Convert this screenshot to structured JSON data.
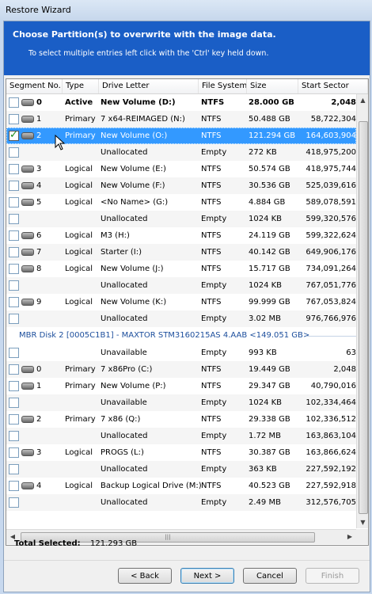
{
  "window": {
    "title": "Restore Wizard"
  },
  "banner": {
    "heading": "Choose  Partition(s)  to overwrite with the image data.",
    "subtext": "To select multiple entries left click with the 'Ctrl' key held down."
  },
  "columns": [
    "Segment No.",
    "Type",
    "Drive Letter",
    "File System",
    "Size",
    "Start Sector"
  ],
  "rows_a": [
    {
      "checked": false,
      "disk": true,
      "seg": "0",
      "type": "Active",
      "drive": "New Volume (D:)",
      "fs": "NTFS",
      "size": "28.000 GB",
      "start": "2,048",
      "style": "bold"
    },
    {
      "checked": false,
      "disk": true,
      "seg": "1",
      "type": "Primary",
      "drive": "7 x64-REIMAGED (N:)",
      "fs": "NTFS",
      "size": "50.488 GB",
      "start": "58,722,304",
      "style": ""
    },
    {
      "checked": true,
      "disk": true,
      "seg": "2",
      "type": "Primary",
      "drive": "New Volume (O:)",
      "fs": "NTFS",
      "size": "121.294 GB",
      "start": "164,603,904",
      "style": "sel"
    },
    {
      "checked": false,
      "disk": false,
      "seg": "",
      "type": "",
      "drive": "Unallocated",
      "fs": "Empty",
      "size": "272 KB",
      "start": "418,975,200",
      "style": ""
    },
    {
      "checked": false,
      "disk": true,
      "seg": "3",
      "type": "Logical",
      "drive": "New Volume (E:)",
      "fs": "NTFS",
      "size": "50.574 GB",
      "start": "418,975,744",
      "style": ""
    },
    {
      "checked": false,
      "disk": true,
      "seg": "4",
      "type": "Logical",
      "drive": "New Volume (F:)",
      "fs": "NTFS",
      "size": "30.536 GB",
      "start": "525,039,616",
      "style": ""
    },
    {
      "checked": false,
      "disk": true,
      "seg": "5",
      "type": "Logical",
      "drive": "<No Name> (G:)",
      "fs": "NTFS",
      "size": "4.884 GB",
      "start": "589,078,591",
      "style": ""
    },
    {
      "checked": false,
      "disk": false,
      "seg": "",
      "type": "",
      "drive": "Unallocated",
      "fs": "Empty",
      "size": "1024 KB",
      "start": "599,320,576",
      "style": ""
    },
    {
      "checked": false,
      "disk": true,
      "seg": "6",
      "type": "Logical",
      "drive": "M3 (H:)",
      "fs": "NTFS",
      "size": "24.119 GB",
      "start": "599,322,624",
      "style": ""
    },
    {
      "checked": false,
      "disk": true,
      "seg": "7",
      "type": "Logical",
      "drive": "Starter (I:)",
      "fs": "NTFS",
      "size": "40.142 GB",
      "start": "649,906,176",
      "style": ""
    },
    {
      "checked": false,
      "disk": true,
      "seg": "8",
      "type": "Logical",
      "drive": "New Volume (J:)",
      "fs": "NTFS",
      "size": "15.717 GB",
      "start": "734,091,264",
      "style": ""
    },
    {
      "checked": false,
      "disk": false,
      "seg": "",
      "type": "",
      "drive": "Unallocated",
      "fs": "Empty",
      "size": "1024 KB",
      "start": "767,051,776",
      "style": ""
    },
    {
      "checked": false,
      "disk": true,
      "seg": "9",
      "type": "Logical",
      "drive": "New Volume (K:)",
      "fs": "NTFS",
      "size": "99.999 GB",
      "start": "767,053,824",
      "style": ""
    },
    {
      "checked": false,
      "disk": false,
      "seg": "",
      "type": "",
      "drive": "Unallocated",
      "fs": "Empty",
      "size": "3.02 MB",
      "start": "976,766,976",
      "style": ""
    }
  ],
  "group_label": "MBR Disk 2 [0005C1B1] - MAXTOR STM3160215AS 4.AAB  <149.051 GB>",
  "rows_b": [
    {
      "checked": false,
      "disk": false,
      "seg": "",
      "type": "",
      "drive": "Unavailable",
      "fs": "Empty",
      "size": "993 KB",
      "start": "63",
      "style": ""
    },
    {
      "checked": false,
      "disk": true,
      "seg": "0",
      "type": "Primary",
      "drive": "7 x86Pro (C:)",
      "fs": "NTFS",
      "size": "19.449 GB",
      "start": "2,048",
      "style": ""
    },
    {
      "checked": false,
      "disk": true,
      "seg": "1",
      "type": "Primary",
      "drive": "New Volume (P:)",
      "fs": "NTFS",
      "size": "29.347 GB",
      "start": "40,790,016",
      "style": ""
    },
    {
      "checked": false,
      "disk": false,
      "seg": "",
      "type": "",
      "drive": "Unavailable",
      "fs": "Empty",
      "size": "1024 KB",
      "start": "102,334,464",
      "style": ""
    },
    {
      "checked": false,
      "disk": true,
      "seg": "2",
      "type": "Primary",
      "drive": "7 x86 (Q:)",
      "fs": "NTFS",
      "size": "29.338 GB",
      "start": "102,336,512",
      "style": ""
    },
    {
      "checked": false,
      "disk": false,
      "seg": "",
      "type": "",
      "drive": "Unallocated",
      "fs": "Empty",
      "size": "1.72 MB",
      "start": "163,863,104",
      "style": ""
    },
    {
      "checked": false,
      "disk": true,
      "seg": "3",
      "type": "Logical",
      "drive": "PROGS (L:)",
      "fs": "NTFS",
      "size": "30.387 GB",
      "start": "163,866,624",
      "style": ""
    },
    {
      "checked": false,
      "disk": false,
      "seg": "",
      "type": "",
      "drive": "Unallocated",
      "fs": "Empty",
      "size": "363 KB",
      "start": "227,592,192",
      "style": ""
    },
    {
      "checked": false,
      "disk": true,
      "seg": "4",
      "type": "Logical",
      "drive": "Backup Logical Drive (M:)",
      "fs": "NTFS",
      "size": "40.523 GB",
      "start": "227,592,918",
      "style": ""
    },
    {
      "checked": false,
      "disk": false,
      "seg": "",
      "type": "",
      "drive": "Unallocated",
      "fs": "Empty",
      "size": "2.49 MB",
      "start": "312,576,705",
      "style": ""
    }
  ],
  "total": {
    "label": "Total Selected:",
    "value": "121.293 GB"
  },
  "buttons": {
    "back": "< Back",
    "next": "Next >",
    "cancel": "Cancel",
    "finish": "Finish"
  },
  "icons": {
    "checkbox": "checkbox-icon",
    "disk": "disk-icon",
    "pointer": "mouse-pointer-icon"
  }
}
